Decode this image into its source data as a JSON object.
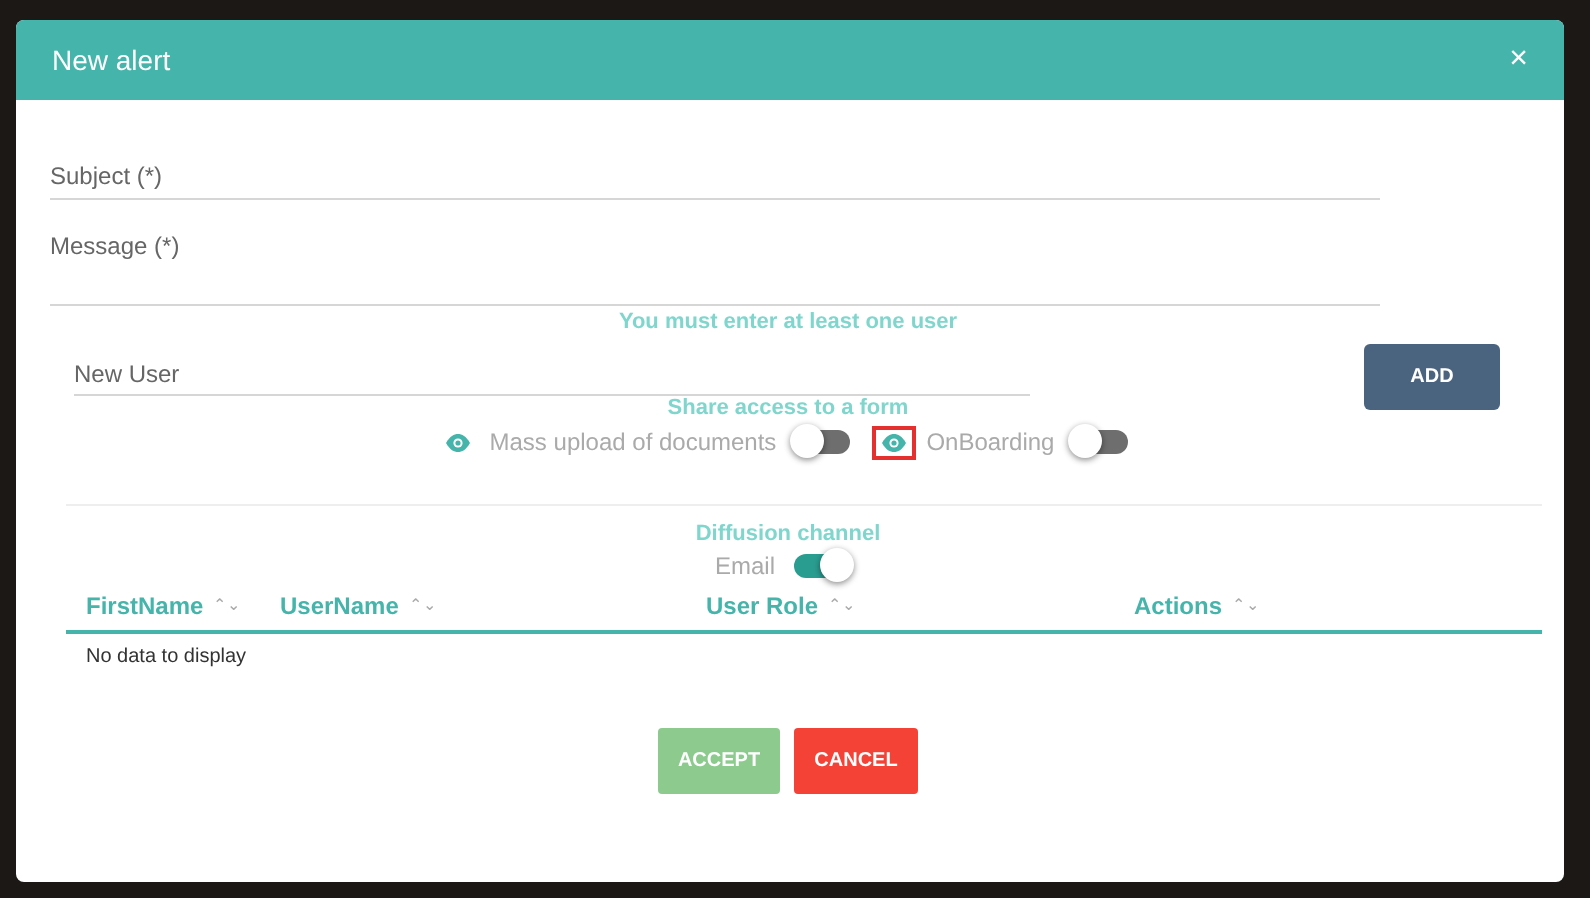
{
  "window": {
    "title": "New alert",
    "close": "×"
  },
  "fields": [
    {
      "placeholder": "Subject (*)",
      "kind": "single"
    },
    {
      "placeholder": "Message (*)",
      "kind": "multi"
    }
  ],
  "error": "You must enter at least one user",
  "new_user": {
    "placeholder": "New User"
  },
  "add_button": "ADD",
  "share": {
    "title": "Share access to a form",
    "forms": [
      {
        "label": "Mass upload of documents",
        "on": false,
        "highlighted": false
      },
      {
        "label": "OnBoarding",
        "on": false,
        "highlighted": true
      }
    ]
  },
  "diffusion": {
    "title": "Diffusion channel",
    "channels": [
      {
        "label": "Email",
        "on": true
      }
    ]
  },
  "table": {
    "columns": [
      {
        "label": "FirstName",
        "sort": "⌃⌄"
      },
      {
        "label": "UserName",
        "sort": "⌃⌄"
      },
      {
        "label": "User Role",
        "sort": "⌃⌄"
      },
      {
        "label": "Actions",
        "sort": "⌃⌄"
      }
    ],
    "empty": "No data to display"
  },
  "buttons": [
    {
      "label": "ACCEPT",
      "kind": "accept"
    },
    {
      "label": "CANCEL",
      "kind": "cancel"
    }
  ]
}
